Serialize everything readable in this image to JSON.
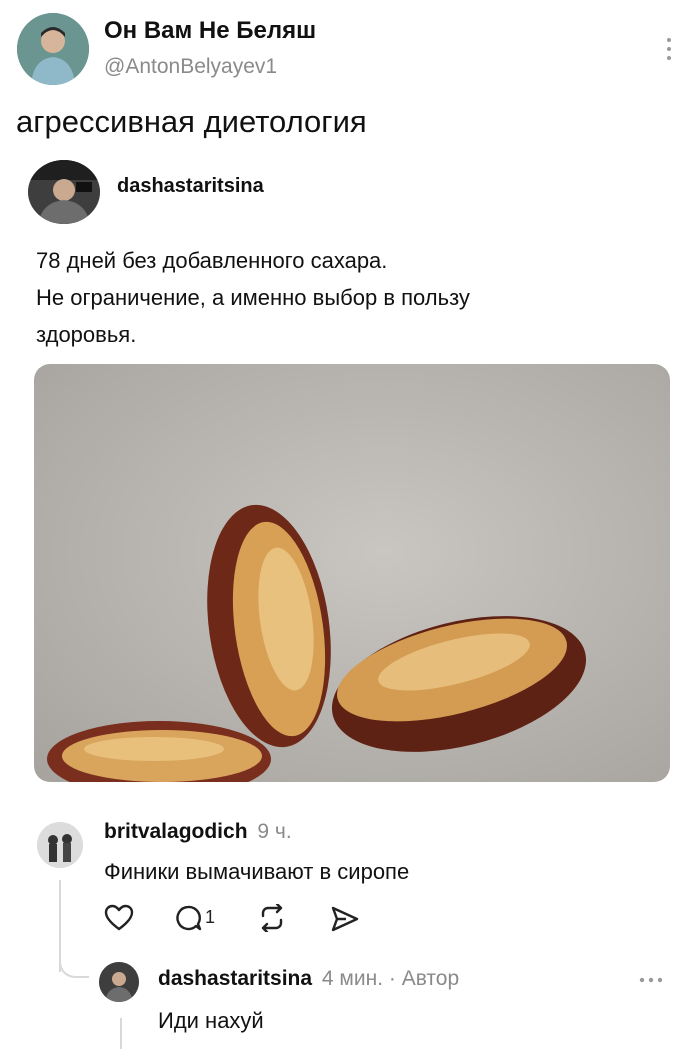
{
  "post": {
    "author_name": "Он Вам Не Беляш",
    "author_handle": "@AntonBelyayev1",
    "text": "агрессивная диетология"
  },
  "quoted": {
    "username": "dashastaritsina",
    "lines": [
      "78 дней без добавленного сахара.",
      "Не ограничение, а именно выбор в пользу",
      "здоровья."
    ]
  },
  "comment": {
    "username": "britvalagodich",
    "time": "9 ч.",
    "text": "Финики вымачивают в сиропе",
    "reply_count": "1"
  },
  "reply": {
    "username": "dashastaritsina",
    "meta": "4 мин. · Автор",
    "text": "Иди нахуй"
  },
  "icons": [
    "more-vertical-icon",
    "heart-icon",
    "comment-icon",
    "repost-icon",
    "share-icon",
    "more-horizontal-icon"
  ]
}
